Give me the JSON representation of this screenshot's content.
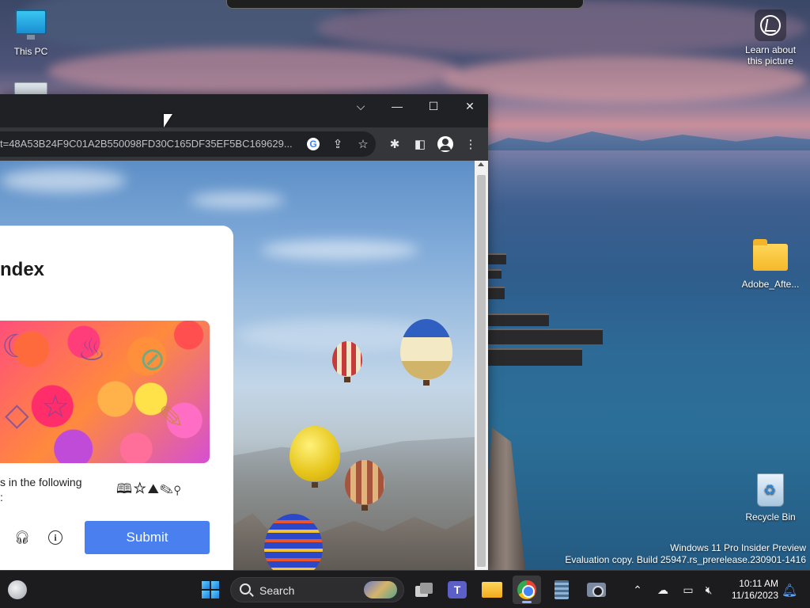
{
  "desktop": {
    "icons": [
      {
        "label": "This PC",
        "icon": "monitor-icon"
      },
      {
        "label": "Learn about this picture",
        "icon": "learn-picture-icon"
      },
      {
        "label": "Adobe_Afte...",
        "icon": "folder-icon"
      },
      {
        "label": "Recycle Bin",
        "icon": "recycle-bin-icon"
      }
    ],
    "watermark": {
      "line1": "Windows 11 Pro Insider Preview",
      "line2": "Evaluation copy. Build 25947.rs_prerelease.230901-1416"
    }
  },
  "browser": {
    "window_controls": {
      "tabs_dropdown": "⌵",
      "minimize": "—",
      "maximize": "☐",
      "close": "✕"
    },
    "url": "t=48A53B24F9C01A2B550098FD30C165DF35EF5BC169629...",
    "omnibox_icons": [
      "google-lens-icon",
      "share-icon",
      "bookmark-star-icon"
    ],
    "toolbar_icons": [
      "extensions-icon",
      "side-panel-icon",
      "profile-icon",
      "menu-icon"
    ]
  },
  "page": {
    "title": "ndex",
    "instruction_text": "s in the following\n:",
    "instruction_lines": [
      "s in the following",
      ":"
    ],
    "glyph_sequence": "🕮☆⛰✎⚲",
    "submit_label": "Submit"
  },
  "taskbar": {
    "search_label": "Search",
    "apps": [
      "start",
      "search",
      "task-view",
      "teams",
      "file-explorer",
      "chrome",
      "calculator",
      "camera"
    ],
    "active_app": "chrome",
    "clock": {
      "time": "10:11 AM",
      "date": "11/16/2023"
    }
  },
  "colors": {
    "submit_button": "#4a7ff0",
    "browser_frame": "#202124",
    "taskbar": "#1c1c1e",
    "notification_bell": "#58a6ff"
  }
}
